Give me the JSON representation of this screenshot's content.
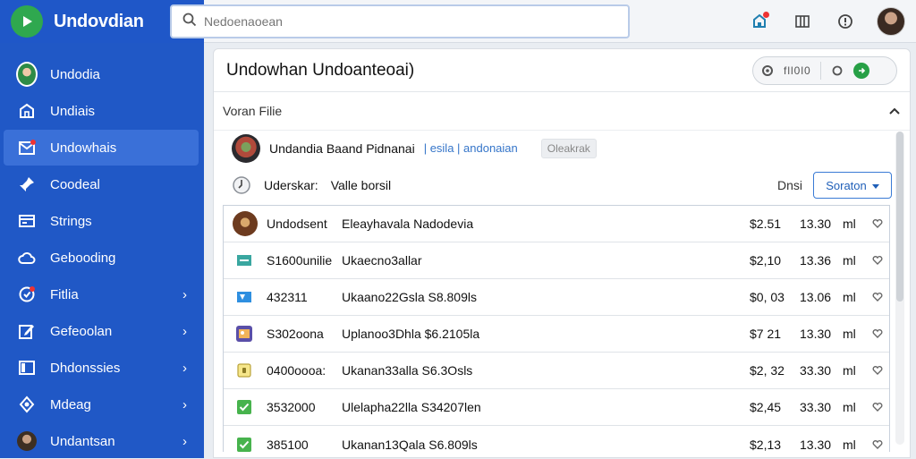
{
  "app": {
    "title": "Undovdian",
    "logo_icon": "play-icon"
  },
  "search": {
    "value": "",
    "placeholder": "Nedoenaoean"
  },
  "topbar": {
    "icons": [
      "notification-icon",
      "columns-icon",
      "help-icon",
      "user-avatar"
    ]
  },
  "sidebar": {
    "items": [
      {
        "label": "Undodia",
        "icon": "profile-avatar",
        "chevron": false,
        "active": false
      },
      {
        "label": "Undiais",
        "icon": "home-icon",
        "chevron": false,
        "active": false
      },
      {
        "label": "Undowhais",
        "icon": "inbox-icon",
        "chevron": false,
        "active": true
      },
      {
        "label": "Coodeal",
        "icon": "pin-icon",
        "chevron": false,
        "active": false
      },
      {
        "label": "Strings",
        "icon": "card-icon",
        "chevron": false,
        "active": false
      },
      {
        "label": "Gebooding",
        "icon": "cloud-icon",
        "chevron": false,
        "active": false
      },
      {
        "label": "Fitlia",
        "icon": "alert-circle-icon",
        "chevron": true,
        "active": false
      },
      {
        "label": "Gefeoolan",
        "icon": "edit-icon",
        "chevron": true,
        "active": false
      },
      {
        "label": "Dhdonssies",
        "icon": "window-icon",
        "chevron": true,
        "active": false
      },
      {
        "label": "Mdeag",
        "icon": "settings-icon",
        "chevron": true,
        "active": false
      },
      {
        "label": "Undantsan",
        "icon": "user-avatar",
        "chevron": true,
        "active": false
      }
    ]
  },
  "main": {
    "title": "Undowhan Undoanteoai)",
    "toolbar_text": "fll0l0",
    "section_label": "Voran Filie",
    "info": {
      "name": "Undandia Baand Pidnanai",
      "links": "| esila | andonaian",
      "tag": "Oleakrak"
    },
    "filter": {
      "key": "Uderskar:",
      "value": "Valle borsil",
      "price_label": "Dnsi",
      "select_label": "Soraton"
    },
    "rows": [
      {
        "icon": "avatar",
        "id": "Undodsent",
        "desc": "Eleayhavala Nadodevia",
        "price": "$2.51",
        "time": "13.30",
        "unit": "ml"
      },
      {
        "icon": "message-icon",
        "id": "S1600unilie",
        "desc": "Ukaecno3allar",
        "price": "$2,10",
        "time": "13.36",
        "unit": "ml"
      },
      {
        "icon": "flag-icon",
        "id": "432311",
        "desc": "Ukaano22Gsla S8.809ls",
        "price": "$0, 03",
        "time": "13.06",
        "unit": "ml"
      },
      {
        "icon": "image-icon",
        "id": "S302oona",
        "desc": "Uplanoo3Dhla $6.2105la",
        "price": "$7 21",
        "time": "13.30",
        "unit": "ml"
      },
      {
        "icon": "lock-icon",
        "id": "0400oooa:",
        "desc": "Ukanan33alla S6.3Osls",
        "price": "$2, 32",
        "time": "33.30",
        "unit": "ml"
      },
      {
        "icon": "check-icon",
        "id": "3532000",
        "desc": "Ulelapha22lla S34207len",
        "price": "$2,45",
        "time": "33.30",
        "unit": "ml"
      },
      {
        "icon": "check-icon",
        "id": "385100",
        "desc": "Ukanan13Qala S6.809ls",
        "price": "$2,13",
        "time": "13.30",
        "unit": "ml"
      }
    ]
  },
  "colors": {
    "sidebar": "#2058c6",
    "accent": "#3a7bd5",
    "success": "#27a046"
  }
}
